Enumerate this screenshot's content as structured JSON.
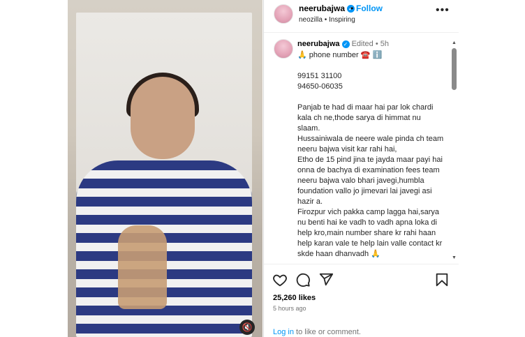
{
  "header": {
    "username": "neerubajwa",
    "follow_label": "Follow",
    "separator": "•",
    "audio": "neozilla",
    "audio_sep": "•",
    "audio_track": "Inspiring",
    "more_label": "•••"
  },
  "caption": {
    "username": "neerubajwa",
    "edited": "Edited",
    "dot": "•",
    "age": "5h",
    "text": "🙏 phone number ☎️ ℹ️\n\n99151 31100\n94650-06035\n\nPanjab te had di maar hai par lok chardi kala ch ne,thode sarya di himmat nu slaam.\nHussainiwala de neere wale pinda ch team neeru bajwa visit kar rahi hai,\nEtho de 15 pind jina te jayda maar payi hai onna de bachya di examination fees team neeru bajwa valo bhari javegi,humbla foundation vallo jo jimevari lai javegi asi hazir a.\nFirozpur vich pakka camp lagga hai,sarya nu benti hai ke vadh to vadh apna loka di help kro,main number share kr rahi haan help karan vale te help lain valle contact kr skde haan dhanvadh 🙏"
  },
  "actions": {
    "likes": "25,260 likes",
    "time": "5 hours ago",
    "login_link": "Log in",
    "login_rest": " to like or comment."
  },
  "icons": {
    "verified": "verified-badge-icon",
    "mute": "sound-off-icon",
    "like": "heart-icon",
    "comment": "comment-icon",
    "share": "share-icon",
    "save": "bookmark-icon"
  },
  "colors": {
    "accent": "#0095f6",
    "muted": "#737373"
  }
}
